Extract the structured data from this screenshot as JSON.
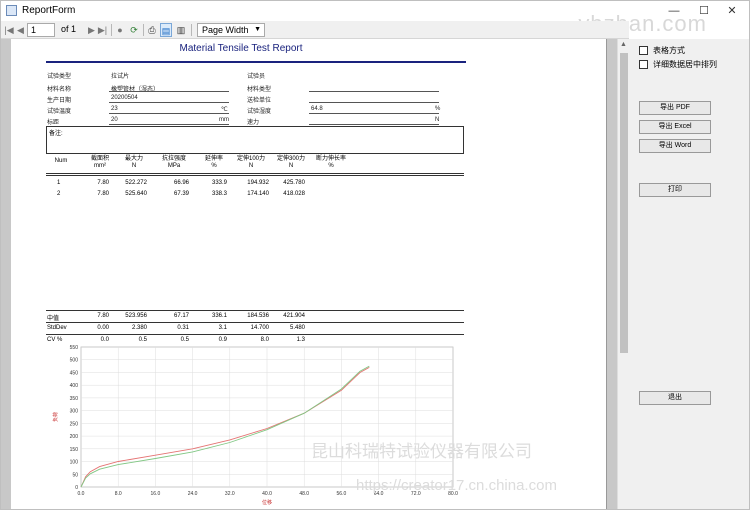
{
  "window": {
    "title": "ReportForm",
    "minimize": "—",
    "maximize": "☐",
    "close": "✕",
    "watermark": "ybzhan.com"
  },
  "toolbar": {
    "first": "|◀",
    "prev": "◀",
    "page_value": "1",
    "of_text": "of  1",
    "next": "▶",
    "last": "▶|",
    "stop": "●",
    "refresh": "⟳",
    "print": "⎙",
    "print_layout": "▤",
    "page_setup": "▥",
    "zoom": "Page Width",
    "zoom_arrow": "▼"
  },
  "report": {
    "title": "Material Tensile Test Report",
    "info_left": [
      {
        "label": "试验类型",
        "value": "拉试片",
        "unit": ""
      },
      {
        "label": "材料名称",
        "value": "橡塑管材（湿态）",
        "unit": ""
      },
      {
        "label": "生产日期",
        "value": "20200504",
        "unit": ""
      },
      {
        "label": "试验温度",
        "value": "23",
        "unit": "℃"
      },
      {
        "label": "标距",
        "value": "20",
        "unit": "mm"
      }
    ],
    "info_right": [
      {
        "label": "试验员",
        "value": "",
        "unit": ""
      },
      {
        "label": "材料类型",
        "value": "",
        "unit": ""
      },
      {
        "label": "送检单位",
        "value": "",
        "unit": ""
      },
      {
        "label": "试验湿度",
        "value": "64.8",
        "unit": "%"
      },
      {
        "label": "速力",
        "value": "",
        "unit": "N"
      }
    ],
    "remark_label": "备注:",
    "table": {
      "headers": [
        {
          "top": "Num",
          "bottom": ""
        },
        {
          "top": "截面积",
          "bottom": "mm²"
        },
        {
          "top": "最大力",
          "bottom": "N"
        },
        {
          "top": "抗拉强度",
          "bottom": "MPa"
        },
        {
          "top": "延伸率",
          "bottom": "%"
        },
        {
          "top": "定伸100力",
          "bottom": "N"
        },
        {
          "top": "定伸300力",
          "bottom": "N"
        },
        {
          "top": "断力伸长率",
          "bottom": "%"
        }
      ],
      "rows": [
        [
          "1",
          "7.80",
          "522.272",
          "66.96",
          "333.9",
          "194.932",
          "425.780",
          ""
        ],
        [
          "2",
          "7.80",
          "525.640",
          "67.39",
          "338.3",
          "174.140",
          "418.028",
          ""
        ]
      ],
      "stats": [
        [
          "中值",
          "7.80",
          "523.956",
          "67.17",
          "336.1",
          "184.536",
          "421.904",
          ""
        ],
        [
          "StdDev",
          "0.00",
          "2.380",
          "0.31",
          "3.1",
          "14.700",
          "5.480",
          ""
        ],
        [
          "CV %",
          "0.0",
          "0.5",
          "0.5",
          "0.9",
          "8.0",
          "1.3",
          ""
        ]
      ]
    }
  },
  "chart_data": {
    "type": "line",
    "title": "",
    "xlabel": "位移",
    "ylabel": "负荷",
    "xlim": [
      0,
      80
    ],
    "ylim": [
      0,
      550
    ],
    "x_ticks": [
      "0.0",
      "8.0",
      "16.0",
      "24.0",
      "32.0",
      "40.0",
      "48.0",
      "56.0",
      "64.0",
      "72.0",
      "80.0"
    ],
    "y_ticks": [
      "0",
      "50",
      "100",
      "150",
      "200",
      "250",
      "300",
      "350",
      "400",
      "450",
      "500",
      "550"
    ],
    "grid": true,
    "series": [
      {
        "color": "#e57373",
        "x": [
          0,
          1,
          2,
          4,
          8,
          16,
          24,
          32,
          40,
          48,
          56,
          60,
          62
        ],
        "y": [
          0,
          40,
          60,
          80,
          100,
          125,
          150,
          185,
          230,
          290,
          380,
          450,
          470
        ]
      },
      {
        "color": "#81c784",
        "x": [
          0,
          1,
          2,
          4,
          8,
          16,
          24,
          32,
          40,
          48,
          56,
          60,
          62
        ],
        "y": [
          0,
          35,
          52,
          70,
          88,
          112,
          138,
          175,
          225,
          290,
          385,
          455,
          475
        ]
      }
    ]
  },
  "side": {
    "checkbox_table": "表格方式",
    "checkbox_center": "详细数据居中排列",
    "export_pdf": "导出    PDF",
    "export_excel": "导出    Excel",
    "export_word": "导出    Word",
    "print": "打印",
    "exit": "退出"
  },
  "watermark": {
    "company": "昆山科瑞特试验仪器有限公司",
    "url": "https://creator17.cn.china.com"
  }
}
